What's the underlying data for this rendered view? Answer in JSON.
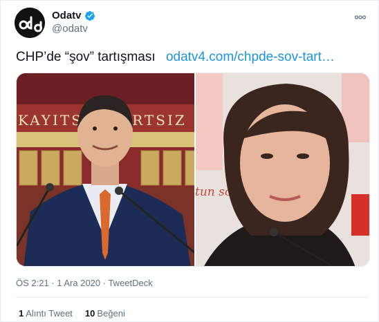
{
  "tweet": {
    "display_name": "Odatv",
    "handle": "@odatv",
    "avatar_text": "odatv",
    "text": "CHP’de “şov” tartışması",
    "link_text": "odatv4.com/chpde-sov-tart…",
    "media_banner_text": "KAYITSIZ ŞARTSIZ",
    "media_sign_text": "tun söz... ahar...",
    "timestamp": "ÖS 2:21 · 1 Ara 2020 · TweetDeck",
    "stats": {
      "quotes_count": "1",
      "quotes_label": "Alıntı Tweet",
      "likes_count": "10",
      "likes_label": "Beğeni"
    }
  },
  "colors": {
    "link": "#1b95e0",
    "secondary_text": "#5b7083",
    "verified": "#1da1f2",
    "divider": "#e6ecf0"
  },
  "icons": {
    "verified": "verified-badge-icon",
    "more": "more-options-icon"
  }
}
